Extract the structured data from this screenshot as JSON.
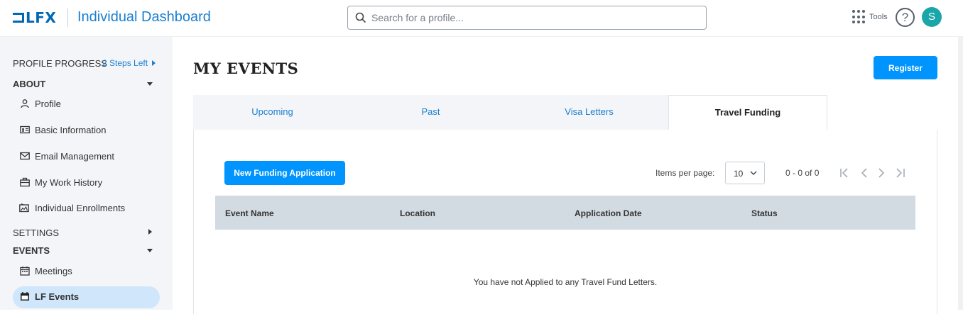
{
  "header": {
    "logo_text": "LFX",
    "app_title": "Individual Dashboard",
    "search_placeholder": "Search for a profile...",
    "tools_label": "Tools",
    "help_glyph": "?",
    "avatar_initial": "S"
  },
  "sidebar": {
    "profile_progress_label": "PROFILE PROGRESS",
    "steps_left": "2 Steps Left",
    "about_label": "ABOUT",
    "about_items": [
      {
        "label": "Profile",
        "icon": "person-icon"
      },
      {
        "label": "Basic Information",
        "icon": "id-card-icon"
      },
      {
        "label": "Email Management",
        "icon": "envelope-icon"
      },
      {
        "label": "My Work History",
        "icon": "briefcase-icon"
      },
      {
        "label": "Individual Enrollments",
        "icon": "enrollment-icon"
      }
    ],
    "settings_label": "SETTINGS",
    "events_label": "EVENTS",
    "events_items": [
      {
        "label": "Meetings",
        "icon": "calendar-icon"
      },
      {
        "label": "LF Events",
        "icon": "calendar-filled-icon",
        "active": true
      }
    ]
  },
  "main": {
    "page_title": "MY EVENTS",
    "register_label": "Register",
    "tabs": [
      {
        "label": "Upcoming"
      },
      {
        "label": "Past"
      },
      {
        "label": "Visa Letters"
      },
      {
        "label": "Travel Funding",
        "active": true
      }
    ],
    "new_application_label": "New Funding Application",
    "items_per_page_label": "Items per page:",
    "items_per_page_value": "10",
    "range_label": "0 - 0 of 0",
    "table_headers": [
      "Event Name",
      "Location",
      "Application Date",
      "Status"
    ],
    "empty_message": "You have not Applied to any Travel Fund Letters."
  },
  "colors": {
    "accent": "#0094ff",
    "link": "#1a7fd0",
    "brand": "#0068b5",
    "sidebar_bg": "#f3f5f8",
    "active_nav_bg": "#cfe6fb",
    "table_header_bg": "#d3dbe2",
    "avatar_bg": "#1aa5a8"
  }
}
